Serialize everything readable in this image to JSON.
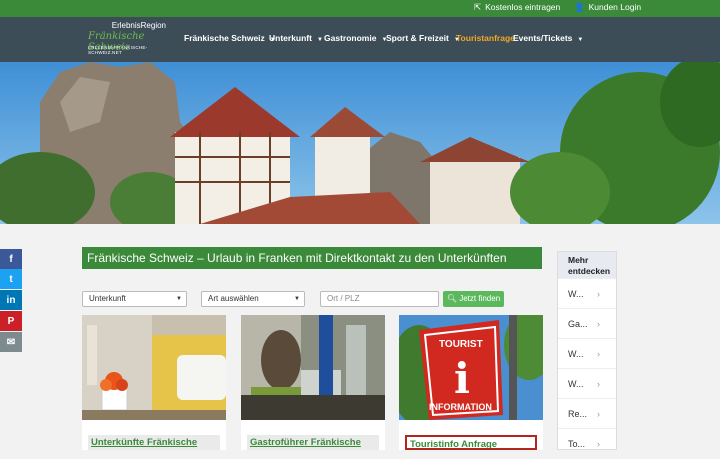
{
  "topbar": {
    "entry_link": "Kostenlos eintragen",
    "login_link": "Kunden Login"
  },
  "logo": {
    "line1": "ErlebnisRegion",
    "line2": "Fränkische Schweiz",
    "line3": "ERLEBNIS-FRÄNKISCHE-SCHWEIZ.NET"
  },
  "nav": [
    {
      "label": "Fränkische Schweiz"
    },
    {
      "label": "Unterkunft"
    },
    {
      "label": "Gastronomie"
    },
    {
      "label": "Sport & Freizeit"
    },
    {
      "label": "Touristanfrage"
    },
    {
      "label": "Events/Tickets"
    }
  ],
  "social": [
    "f",
    "t",
    "in",
    "P",
    "✉"
  ],
  "headline": "Fränkische Schweiz – Urlaub in Franken mit Direktkontakt zu den Unterkünften",
  "search": {
    "category_value": "Unterkunft",
    "type_value": "Art auswählen",
    "location_placeholder": "Ort / PLZ",
    "submit_label": "Jetzt finden"
  },
  "cards": [
    {
      "title": "Unterkünfte Fränkische"
    },
    {
      "title": "Gastroführer Fränkische"
    },
    {
      "title": "Touristinfo Anfrage"
    }
  ],
  "info_sign": {
    "line1": "TOURIST",
    "line2": "i",
    "line3": "INFORMATION"
  },
  "sidebar": {
    "heading_line1": "Mehr",
    "heading_line2": "entdecken",
    "items": [
      "W...",
      "Ga...",
      "W...",
      "W...",
      "Re...",
      "To..."
    ]
  },
  "colors": {
    "brand_green": "#3a8a3a",
    "nav_bg": "#3d4d58",
    "highlight": "#f5a623",
    "button_green": "#5cb85c"
  }
}
